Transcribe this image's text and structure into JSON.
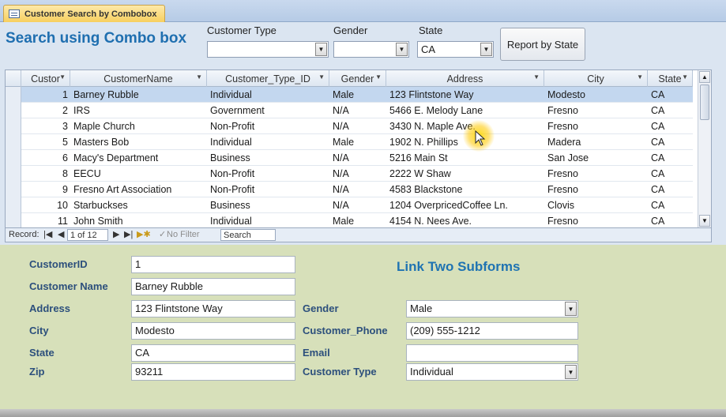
{
  "tab": {
    "title": "Customer Search by Combobox"
  },
  "header": {
    "title": "Search using Combo box",
    "customer_type_label": "Customer Type",
    "customer_type_value": "",
    "gender_label": "Gender",
    "gender_value": "",
    "state_label": "State",
    "state_value": "CA",
    "report_button": "Report by State"
  },
  "table": {
    "columns": [
      "Custor",
      "CustomerName",
      "Customer_Type_ID",
      "Gender",
      "Address",
      "City",
      "State"
    ],
    "rows": [
      {
        "id": "1",
        "name": "Barney Rubble",
        "type": "Individual",
        "gender": "Male",
        "address": "123 Flintstone Way",
        "city": "Modesto",
        "state": "CA"
      },
      {
        "id": "2",
        "name": "IRS",
        "type": "Government",
        "gender": "N/A",
        "address": "5466 E. Melody Lane",
        "city": "Fresno",
        "state": "CA"
      },
      {
        "id": "3",
        "name": "Maple Church",
        "type": "Non-Profit",
        "gender": "N/A",
        "address": "3430 N. Maple Ave.",
        "city": "Fresno",
        "state": "CA"
      },
      {
        "id": "5",
        "name": "Masters Bob",
        "type": "Individual",
        "gender": "Male",
        "address": "1902 N. Phillips",
        "city": "Madera",
        "state": "CA"
      },
      {
        "id": "6",
        "name": "Macy's Department",
        "type": "Business",
        "gender": "N/A",
        "address": "5216 Main St",
        "city": "San Jose",
        "state": "CA"
      },
      {
        "id": "8",
        "name": "EECU",
        "type": "Non-Profit",
        "gender": "N/A",
        "address": "2222 W Shaw",
        "city": "Fresno",
        "state": "CA"
      },
      {
        "id": "9",
        "name": "Fresno Art Association",
        "type": "Non-Profit",
        "gender": "N/A",
        "address": "4583 Blackstone",
        "city": "Fresno",
        "state": "CA"
      },
      {
        "id": "10",
        "name": "Starbuckses",
        "type": "Business",
        "gender": "N/A",
        "address": "1204 OverpricedCoffee Ln.",
        "city": "Clovis",
        "state": "CA"
      },
      {
        "id": "11",
        "name": "John Smith",
        "type": "Individual",
        "gender": "Male",
        "address": "4154 N. Nees Ave.",
        "city": "Fresno",
        "state": "CA"
      }
    ]
  },
  "navigation": {
    "record_label": "Record:",
    "position": "1 of 12",
    "filter": "No Filter",
    "search": "Search"
  },
  "detail": {
    "link_title": "Link Two Subforms",
    "customer_id_label": "CustomerID",
    "customer_id": "1",
    "customer_name_label": "Customer Name",
    "customer_name": "Barney Rubble",
    "address_label": "Address",
    "address": "123 Flintstone Way",
    "city_label": "City",
    "city": "Modesto",
    "state_label": "State",
    "state": "CA",
    "zip_label": "Zip",
    "zip": "93211",
    "gender_label": "Gender",
    "gender": "Male",
    "phone_label": "Customer_Phone",
    "phone": "(209) 555-1212",
    "email_label": "Email",
    "email": "",
    "customer_type_label": "Customer Type",
    "customer_type": "Individual"
  }
}
